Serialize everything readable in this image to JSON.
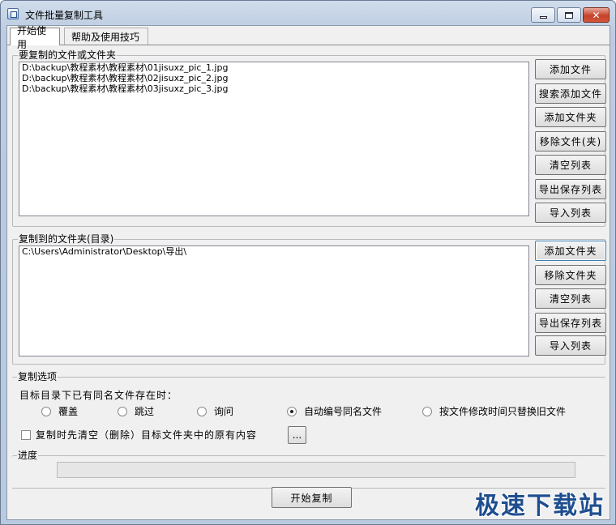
{
  "window": {
    "title": "文件批量复制工具"
  },
  "tabs": [
    {
      "label": "开始使用"
    },
    {
      "label": "帮助及使用技巧"
    }
  ],
  "source_group": {
    "label": "要复制的文件或文件夹",
    "files": [
      "D:\\backup\\教程素材\\教程素材\\01jisuxz_pic_1.jpg",
      "D:\\backup\\教程素材\\教程素材\\02jisuxz_pic_2.jpg",
      "D:\\backup\\教程素材\\教程素材\\03jisuxz_pic_3.jpg"
    ],
    "buttons": {
      "add_file": "添加文件",
      "search_add": "搜索添加文件",
      "add_folder": "添加文件夹",
      "remove": "移除文件(夹)",
      "clear": "清空列表",
      "export": "导出保存列表",
      "import": "导入列表"
    }
  },
  "dest_group": {
    "label": "复制到的文件夹(目录)",
    "folders": [
      "C:\\Users\\Administrator\\Desktop\\导出\\"
    ],
    "buttons": {
      "add_folder": "添加文件夹",
      "remove_folder": "移除文件夹",
      "clear": "清空列表",
      "export": "导出保存列表",
      "import": "导入列表"
    }
  },
  "options": {
    "label": "复制选项",
    "prompt": "目标目录下已有同名文件存在时：",
    "radios": [
      {
        "label": "覆盖",
        "selected": false
      },
      {
        "label": "跳过",
        "selected": false
      },
      {
        "label": "询问",
        "selected": false
      },
      {
        "label": "自动编号同名文件",
        "selected": true
      },
      {
        "label": "按文件修改时间只替换旧文件",
        "selected": false
      }
    ],
    "clear_checkbox": {
      "label": "复制时先清空（删除）目标文件夹中的原有内容",
      "checked": false
    },
    "more_button": "..."
  },
  "progress": {
    "label": "进度",
    "value": 0
  },
  "start_button": "开始复制",
  "watermark": "极速下载站"
}
